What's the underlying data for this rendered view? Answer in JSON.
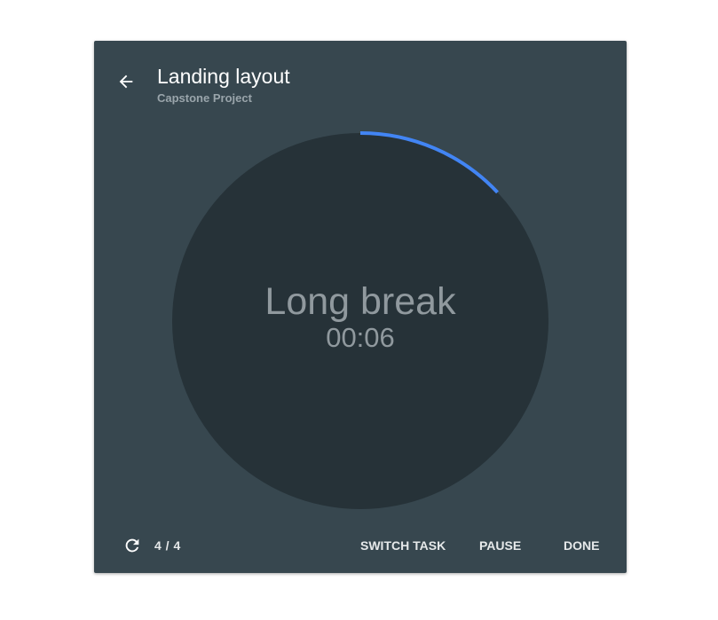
{
  "header": {
    "title": "Landing layout",
    "subtitle": "Capstone Project",
    "back_icon": "arrow-back-icon"
  },
  "timer": {
    "phase_label": "Long break",
    "time_remaining": "00:06",
    "progress_fraction": 0.13,
    "track_color": "#263238",
    "progress_color": "#4285f4"
  },
  "footer": {
    "reset_icon": "refresh-icon",
    "session_count": "4 / 4",
    "switch_task_label": "SWITCH TASK",
    "pause_label": "PAUSE",
    "done_label": "DONE"
  },
  "colors": {
    "card_background": "#37474f",
    "page_background": "#ffffff",
    "text_primary": "#ffffff",
    "text_muted": "#90999e"
  }
}
